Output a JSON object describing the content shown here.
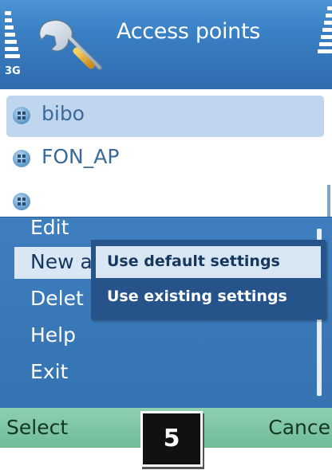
{
  "status": {
    "network": "3G"
  },
  "header": {
    "title": "Access points",
    "icon": "wrench-icon"
  },
  "list": {
    "items": [
      {
        "label": "bibo",
        "selected": true
      },
      {
        "label": "FON_AP",
        "selected": false
      },
      {
        "label": "",
        "selected": false
      }
    ]
  },
  "menu": {
    "items": [
      {
        "label": "Edit"
      },
      {
        "label": "New a"
      },
      {
        "label": "Delet"
      },
      {
        "label": "Help"
      },
      {
        "label": "Exit"
      }
    ],
    "highlighted_index": 1
  },
  "submenu": {
    "items": [
      {
        "label": "Use default settings",
        "highlighted": true
      },
      {
        "label": "Use existing settings",
        "highlighted": false
      }
    ]
  },
  "softkeys": {
    "left": "Select",
    "right": "Cance"
  },
  "step_badge": "5",
  "colors": {
    "titlebar": "#3a80c5",
    "menu_bg": "#3a7aba",
    "highlight": "#d9e6f4",
    "submenu_bg": "#25538a",
    "softkey_bg": "#7fc6a3"
  }
}
